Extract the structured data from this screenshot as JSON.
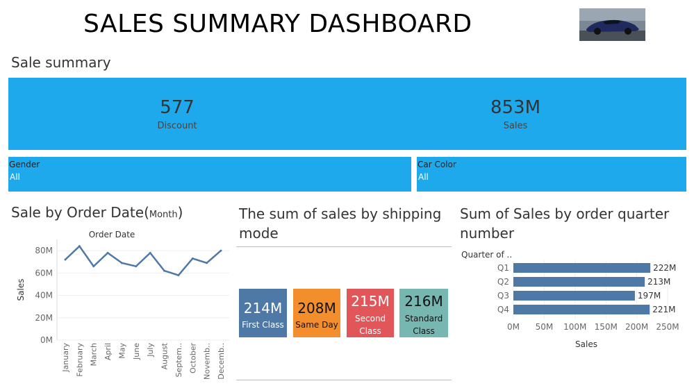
{
  "header": {
    "title": "SALES SUMMARY DASHBOARD"
  },
  "summary": {
    "title": "Sale summary",
    "kpis": [
      {
        "value": "577",
        "label": "Discount"
      },
      {
        "value": "853M",
        "label": "Sales"
      }
    ]
  },
  "filters": [
    {
      "title": "Gender",
      "value": "All"
    },
    {
      "title": "Car Color",
      "value": "All"
    }
  ],
  "colors": {
    "accent_blue": "#1ea9ec",
    "line": "#4e79a7",
    "first_class": "#4e79a7",
    "same_day": "#f28e2b",
    "second_class": "#e15759",
    "standard_class": "#76b7b2"
  },
  "line_panel": {
    "title": "Sale by Order Date",
    "title_suffix": "Month"
  },
  "shipping_panel": {
    "title_line1": "The sum of sales by shipping",
    "title_line2": "mode"
  },
  "quarter_panel": {
    "title_line1": "Sum of Sales by order quarter",
    "title_line2": "number"
  },
  "chart_data": [
    {
      "type": "line",
      "title": "Order Date",
      "xlabel": "",
      "ylabel": "Sales",
      "x": [
        "January",
        "February",
        "March",
        "April",
        "May",
        "June",
        "July",
        "August",
        "Septem..",
        "October",
        "Novemb..",
        "Decemb.."
      ],
      "series": [
        {
          "values": [
            72,
            84,
            66,
            78,
            69,
            66,
            78,
            62,
            58,
            73,
            69,
            80
          ]
        }
      ],
      "yticks": [
        "0M",
        "20M",
        "40M",
        "60M",
        "80M"
      ],
      "ylim": [
        0,
        90
      ],
      "grid": true
    },
    {
      "type": "table",
      "categories": [
        "First Class",
        "Same Day",
        "Second Class",
        "Standard Class"
      ],
      "values_label": [
        "214M",
        "208M",
        "215M",
        "216M"
      ],
      "values": [
        214,
        208,
        215,
        216
      ]
    },
    {
      "type": "bar",
      "orientation": "horizontal",
      "category_header": "Quarter of ..",
      "categories": [
        "Q1",
        "Q2",
        "Q3",
        "Q4"
      ],
      "values": [
        222,
        213,
        197,
        221
      ],
      "value_labels": [
        "222M",
        "213M",
        "197M",
        "221M"
      ],
      "xlabel": "Sales",
      "xticks": [
        "0M",
        "50M",
        "100M",
        "150M",
        "200M",
        "250M"
      ],
      "xlim": [
        0,
        250
      ],
      "grid": true
    }
  ]
}
